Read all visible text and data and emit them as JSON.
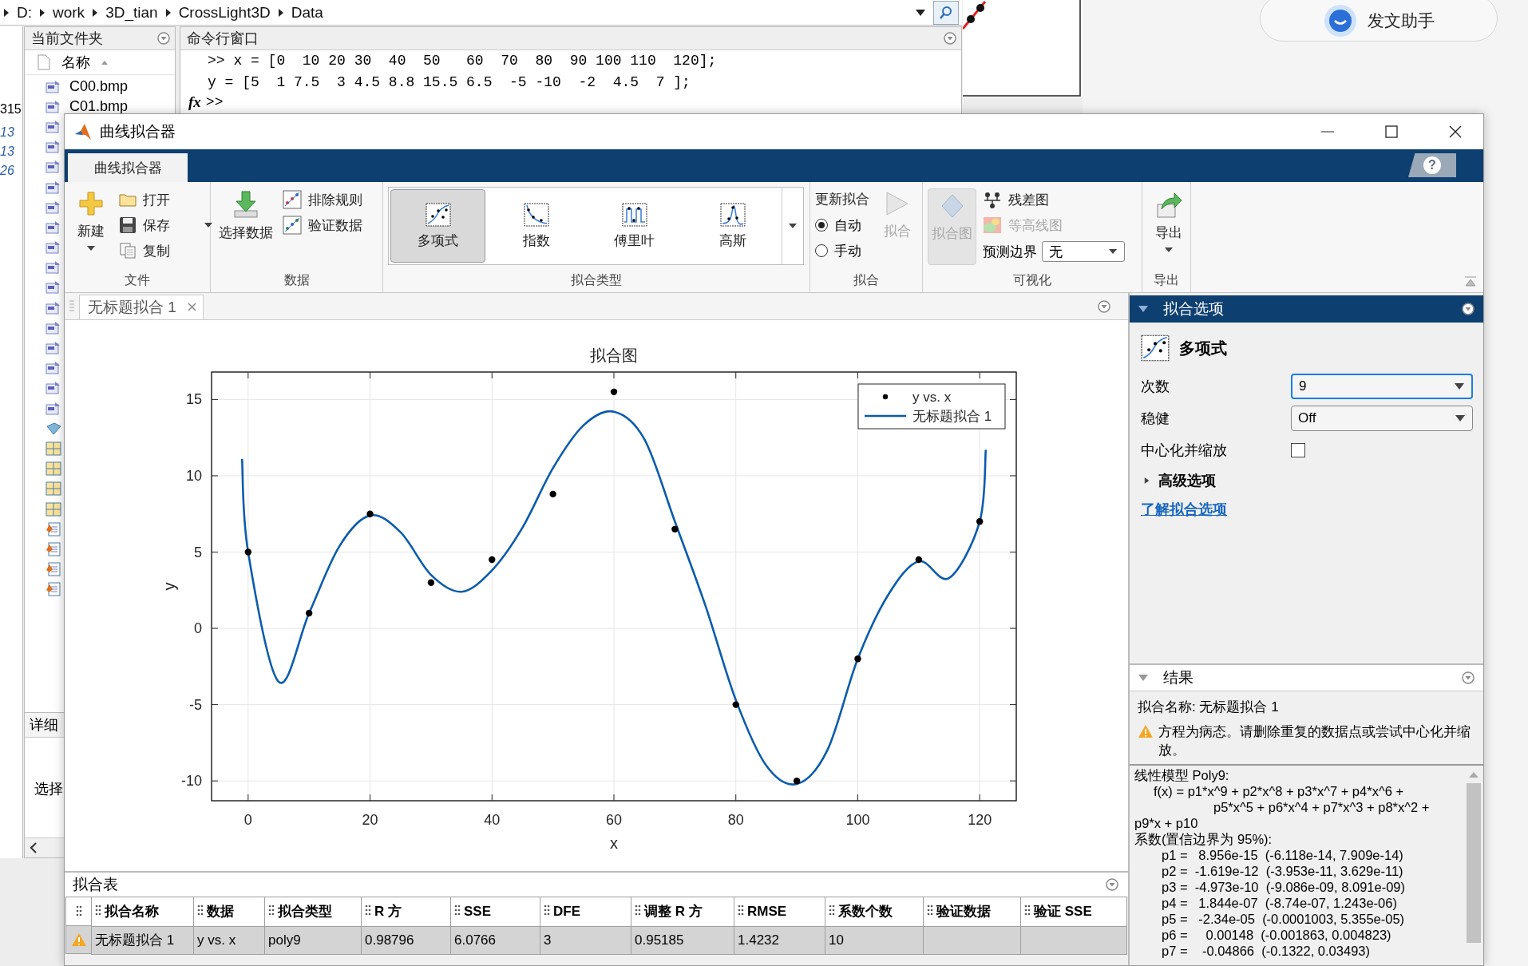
{
  "desktop": {
    "breadcrumb": [
      "D:",
      "work",
      "3D_tian",
      "CrossLight3D",
      "Data"
    ],
    "side_strip": [
      "315",
      "13",
      "13",
      "26"
    ],
    "current_folder": {
      "title": "当前文件夹",
      "column": "名称",
      "files": [
        {
          "kind": "image",
          "name": "C00.bmp"
        },
        {
          "kind": "image",
          "name": "C01.bmp"
        },
        {
          "kind": "image"
        },
        {
          "kind": "image"
        },
        {
          "kind": "image"
        },
        {
          "kind": "image"
        },
        {
          "kind": "image"
        },
        {
          "kind": "image"
        },
        {
          "kind": "image"
        },
        {
          "kind": "image"
        },
        {
          "kind": "image"
        },
        {
          "kind": "image"
        },
        {
          "kind": "image"
        },
        {
          "kind": "image"
        },
        {
          "kind": "image"
        },
        {
          "kind": "image"
        },
        {
          "kind": "image"
        },
        {
          "kind": "model"
        },
        {
          "kind": "table"
        },
        {
          "kind": "table"
        },
        {
          "kind": "table"
        },
        {
          "kind": "table"
        },
        {
          "kind": "script"
        },
        {
          "kind": "script"
        },
        {
          "kind": "script"
        },
        {
          "kind": "script"
        }
      ],
      "details": "详细",
      "selection": "选择"
    },
    "command_window": {
      "title": "命令行窗口",
      "lines": [
        ">> x = [0  10 20 30  40  50   60  70  80  90 100 110  120];",
        "y = [5  1 7.5  3 4.5 8.8 15.5 6.5  -5 -10  -2  4.5  7 ];"
      ],
      "prompt_icon": "fx",
      "prompt": ">>"
    },
    "assistant_button": "发文助手"
  },
  "fitter": {
    "title": "曲线拟合器",
    "app_tab": "曲线拟合器",
    "help": "?",
    "ribbon": [
      {
        "label": "文件",
        "items": [
          {
            "kind": "large",
            "label": "新建",
            "disabled": false,
            "has_menu": true
          },
          {
            "kind": "small",
            "label": "打开",
            "disabled": false,
            "has_menu": false
          },
          {
            "kind": "small",
            "label": "保存",
            "disabled": false,
            "has_menu": true
          },
          {
            "kind": "small",
            "label": "复制",
            "disabled": false,
            "has_menu": false
          }
        ]
      },
      {
        "label": "数据",
        "items": [
          {
            "kind": "large",
            "label": "选择数据",
            "disabled": false,
            "has_menu": false
          },
          {
            "kind": "small",
            "label": "排除规则",
            "disabled": false,
            "has_menu": false
          },
          {
            "kind": "small",
            "label": "验证数据",
            "disabled": false,
            "has_menu": false
          }
        ]
      },
      {
        "label": "拟合类型",
        "items": [
          {
            "kind": "gallery",
            "options": [
              {
                "label": "多项式",
                "selected": true
              },
              {
                "label": "指数",
                "selected": false
              },
              {
                "label": "傅里叶",
                "selected": false
              },
              {
                "label": "高斯",
                "selected": false
              }
            ]
          }
        ]
      },
      {
        "label": "拟合",
        "items": [
          {
            "kind": "heading",
            "label": "更新拟合"
          },
          {
            "kind": "radio",
            "label": "自动",
            "selected": true
          },
          {
            "kind": "radio",
            "label": "手动",
            "selected": false
          },
          {
            "kind": "large",
            "label": "拟合",
            "disabled": true,
            "has_menu": false
          }
        ]
      },
      {
        "label": "可视化",
        "items": [
          {
            "kind": "large",
            "label": "拟合图",
            "disabled": true,
            "has_menu": false
          },
          {
            "kind": "small",
            "label": "残差图",
            "disabled": false,
            "has_menu": false
          },
          {
            "kind": "small",
            "label": "等高线图",
            "disabled": true,
            "has_menu": false
          },
          {
            "kind": "select",
            "label": "预测边界",
            "value": "无"
          }
        ]
      },
      {
        "label": "导出",
        "items": [
          {
            "kind": "large",
            "label": "导出",
            "disabled": false,
            "has_menu": true
          }
        ]
      }
    ],
    "document_tabs": [
      {
        "label": "无标题拟合 1",
        "selected": true,
        "closable": true
      }
    ],
    "plot": {
      "chart_data": {
        "type": "scatter",
        "title": "拟合图",
        "xlabel": "x",
        "ylabel": "y",
        "x": [
          0,
          10,
          20,
          30,
          40,
          50,
          60,
          70,
          80,
          90,
          100,
          110,
          120
        ],
        "series": [
          {
            "name": "y vs. x",
            "color": "#000000",
            "values": [
              5,
              1,
              7.5,
              3,
              4.5,
              8.8,
              15.5,
              6.5,
              -5,
              -10,
              -2,
              4.5,
              7
            ]
          },
          {
            "name": "无标题拟合 1",
            "type": "line",
            "color": "#0a5cad",
            "x": [
              -1,
              0,
              5,
              10,
              15,
              20,
              25,
              30,
              35,
              40,
              45,
              50,
              55,
              60,
              65,
              70,
              75,
              80,
              85,
              90,
              95,
              100,
              105,
              110,
              115,
              120,
              121
            ],
            "values": [
              11.1,
              5,
              -3.5,
              1,
              5.4,
              7.4,
              6.3,
              3.5,
              2.4,
              3.8,
              6.6,
              10.5,
              13.3,
              14.2,
              12.4,
              7,
              1.5,
              -4.7,
              -9,
              -10.2,
              -8,
              -2,
              2.2,
              4.4,
              3.3,
              7,
              11.7
            ]
          }
        ],
        "xlim": [
          -6,
          126
        ],
        "ylim": [
          -11.3,
          16.8
        ],
        "xticks": [
          0,
          20,
          40,
          60,
          80,
          100,
          120
        ],
        "yticks": [
          -10,
          -5,
          0,
          5,
          10,
          15
        ],
        "grid": true,
        "legend": true
      }
    },
    "fit_options": {
      "title": "拟合选项",
      "fit_type": "多项式",
      "fields": [
        {
          "label": "次数",
          "value": "9",
          "focused": true
        },
        {
          "label": "稳健",
          "value": "Off",
          "focused": false
        }
      ],
      "center_scale": {
        "label": "中心化并缩放",
        "checked": false
      },
      "advanced": {
        "label": "高级选项",
        "expanded": false
      },
      "help_link": "了解拟合选项"
    },
    "results": {
      "title": "结果",
      "fit_name": "拟合名称: 无标题拟合 1",
      "warning": "方程为病态。请删除重复的数据点或尝试中心化并缩放。",
      "output": [
        {
          "kind": "heading",
          "text": "线性模型 Poly9:"
        },
        {
          "kind": "formula",
          "text": "f(x) = p1*x^9 + p2*x^8 + p3*x^7 + p4*x^6 +"
        },
        {
          "kind": "continuation",
          "text": "p5*x^5 + p6*x^4 + p7*x^3 + p8*x^2 +"
        },
        {
          "kind": "heading",
          "text": "p9*x + p10"
        },
        {
          "kind": "heading",
          "text": "系数(置信边界为 95%):"
        },
        {
          "kind": "coefficient",
          "text": "p1 =   8.956e-15  (-6.118e-14, 7.909e-14)"
        },
        {
          "kind": "coefficient",
          "text": "p2 =  -1.619e-12  (-3.953e-11, 3.629e-11)"
        },
        {
          "kind": "coefficient",
          "text": "p3 =  -4.973e-10  (-9.086e-09, 8.091e-09)"
        },
        {
          "kind": "coefficient",
          "text": "p4 =   1.844e-07  (-8.74e-07, 1.243e-06)"
        },
        {
          "kind": "coefficient",
          "text": "p5 =   -2.34e-05  (-0.0001003, 5.355e-05)"
        },
        {
          "kind": "coefficient",
          "text": "p6 =     0.00148  (-0.001863, 0.004823)"
        },
        {
          "kind": "coefficient",
          "text": "p7 =    -0.04866  (-0.1322, 0.03493)"
        }
      ]
    },
    "fit_table": {
      "title": "拟合表",
      "columns": [
        "拟合名称",
        "数据",
        "拟合类型",
        "R 方",
        "SSE",
        "DFE",
        "调整 R 方",
        "RMSE",
        "系数个数",
        "验证数据",
        "验证 SSE"
      ],
      "rows": [
        {
          "selected": true,
          "warning": true,
          "cells": [
            "无标题拟合 1",
            "y vs. x",
            "poly9",
            "0.98796",
            "6.0766",
            "3",
            "0.95185",
            "1.4232",
            "10"
          ]
        }
      ]
    }
  }
}
